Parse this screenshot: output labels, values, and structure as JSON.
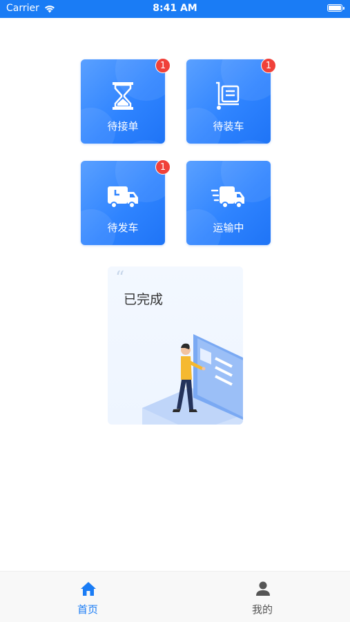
{
  "status_bar": {
    "carrier": "Carrier",
    "time": "8:41 AM"
  },
  "tiles": [
    {
      "label": "待接单",
      "badge": "1",
      "icon": "hourglass-icon"
    },
    {
      "label": "待装车",
      "badge": "1",
      "icon": "cart-icon"
    },
    {
      "label": "待发车",
      "badge": "1",
      "icon": "truck-icon"
    },
    {
      "label": "运输中",
      "icon": "moving-truck-icon"
    }
  ],
  "completed": {
    "title": "已完成"
  },
  "tab_bar": {
    "tabs": [
      {
        "label": "首页",
        "icon": "home-icon",
        "active": true
      },
      {
        "label": "我的",
        "icon": "person-icon",
        "active": false
      }
    ]
  },
  "colors": {
    "accent": "#1a7cf5",
    "tile": "#2f84ff",
    "badge": "#f0413a",
    "inactive": "#555555"
  }
}
